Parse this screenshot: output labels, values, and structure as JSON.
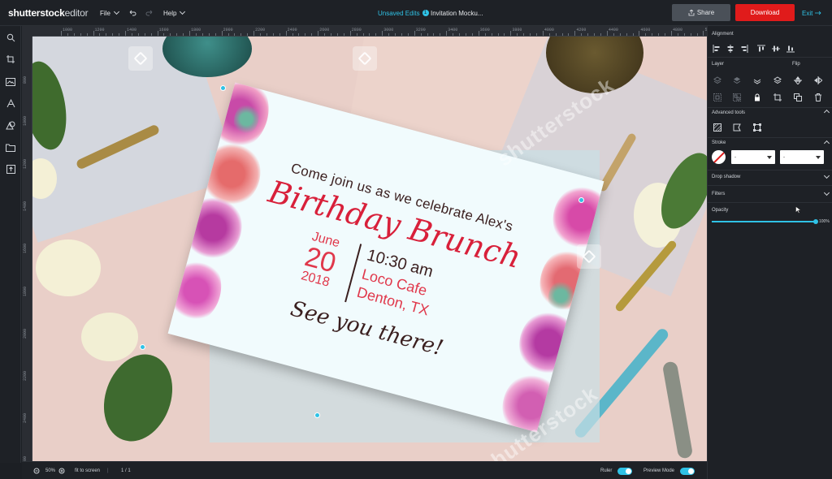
{
  "app": {
    "brand_bold": "shutterstock",
    "brand_light": "editor"
  },
  "topbar": {
    "file_label": "File",
    "help_label": "Help",
    "unsaved_label": "Unsaved Edits",
    "unsaved_count": "1",
    "doc_title": "Invitation Mocku...",
    "share_label": "Share",
    "download_label": "Download",
    "exit_label": "Exit"
  },
  "left_tools": [
    "search-icon",
    "crop-icon",
    "image-icon",
    "text-icon",
    "shapes-icon",
    "folder-icon",
    "upload-icon"
  ],
  "ruler": {
    "h_ticks": [
      "1000",
      "1200",
      "1400",
      "1600",
      "1800",
      "2000",
      "2200",
      "2400",
      "2600",
      "2800",
      "3000",
      "3200",
      "3400",
      "3600",
      "3800",
      "4000",
      "4200",
      "4400",
      "4600",
      "4800",
      "5000"
    ],
    "v_ticks": [
      "800",
      "1000",
      "1200",
      "1400",
      "1600",
      "1800",
      "2000",
      "2200",
      "2400",
      "2600"
    ]
  },
  "card": {
    "line1": "Come join us as we celebrate Alex's",
    "line2": "Birthday Brunch",
    "month": "June",
    "day": "20",
    "year": "2018",
    "time": "10:30 am",
    "place": "Loco Cafe",
    "city": "Denton, TX",
    "line3": "See you there!"
  },
  "watermark": {
    "text": "shutterstock"
  },
  "bottombar": {
    "zoom": "50%",
    "fit_label": "fit to screen",
    "pages": "1 / 1",
    "ruler_label": "Ruler",
    "preview_label": "Preview Mode"
  },
  "panel": {
    "alignment_label": "Alignment",
    "layer_label": "Layer",
    "flip_label": "Flip",
    "advanced_label": "Advanced tools",
    "stroke_label": "Stroke",
    "stroke_select1": "-",
    "stroke_select2": "-",
    "drop_shadow_label": "Drop shadow",
    "filters_label": "Filters",
    "opacity_label": "Opacity",
    "opacity_value": "100%",
    "opacity_level": 1.0
  },
  "colors": {
    "accent": "#2fc2e6",
    "download": "#e01b1b",
    "title_red": "#d8203a"
  }
}
